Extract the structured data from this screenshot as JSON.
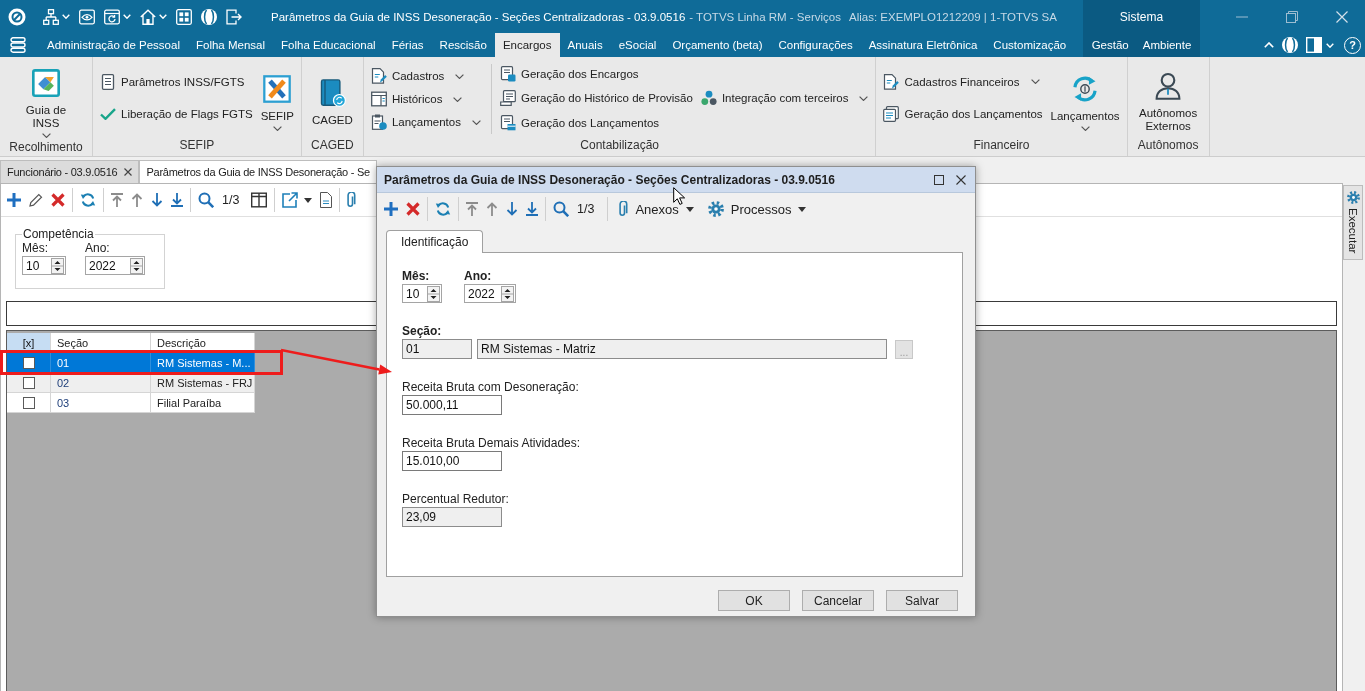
{
  "window": {
    "title": "Parâmetros da Guia de INSS Desoneração - Seções Centralizadoras - 03.9.0516",
    "product": "- TOTVS Linha RM - Serviços",
    "alias": "Alias: EXEMPLO1212209 | 1-TOTVS SA",
    "system_label": "Sistema"
  },
  "menu": {
    "items": [
      {
        "label": "Administração de Pessoal",
        "selected": false
      },
      {
        "label": "Folha Mensal",
        "selected": false
      },
      {
        "label": "Folha Educacional",
        "selected": false
      },
      {
        "label": "Férias",
        "selected": false
      },
      {
        "label": "Rescisão",
        "selected": false
      },
      {
        "label": "Encargos",
        "selected": true
      },
      {
        "label": "Anuais",
        "selected": false
      },
      {
        "label": "eSocial",
        "selected": false
      },
      {
        "label": "Orçamento (beta)",
        "selected": false
      },
      {
        "label": "Configurações",
        "selected": false
      },
      {
        "label": "Assinatura Eletrônica",
        "selected": false
      },
      {
        "label": "Customização",
        "selected": false
      }
    ],
    "system_items": [
      {
        "label": "Gestão",
        "selected": false
      },
      {
        "label": "Ambiente",
        "selected": false
      }
    ],
    "help_label": "?"
  },
  "ribbon": {
    "groups": [
      {
        "label": "Recolhimento",
        "columns": [
          {
            "divider": false,
            "items": [
              {
                "kind": "large",
                "lines": [
                  "Guia de",
                  "INSS"
                ],
                "dropdown": true
              }
            ]
          }
        ]
      },
      {
        "label": "SEFIP",
        "columns": [
          {
            "divider": false,
            "items": [
              {
                "kind": "small",
                "label": "Parâmetros INSS/FGTS",
                "dropdown": false
              },
              {
                "kind": "small",
                "label": "Liberação de Flags FGTS",
                "dropdown": false
              }
            ]
          },
          {
            "divider": false,
            "items": [
              {
                "kind": "large",
                "lines": [
                  "SEFIP"
                ],
                "dropdown": true
              }
            ]
          }
        ]
      },
      {
        "label": "CAGED",
        "columns": [
          {
            "divider": false,
            "items": [
              {
                "kind": "large",
                "lines": [
                  "CAGED"
                ],
                "dropdown": false
              }
            ]
          }
        ]
      },
      {
        "label": "Contabilização",
        "columns": [
          {
            "divider": true,
            "items": [
              {
                "kind": "small",
                "label": "Cadastros",
                "dropdown": true
              },
              {
                "kind": "small",
                "label": "Históricos",
                "dropdown": true
              },
              {
                "kind": "small",
                "label": "Lançamentos",
                "dropdown": true
              }
            ]
          },
          {
            "divider": false,
            "items": [
              {
                "kind": "small",
                "label": "Geração dos Encargos",
                "dropdown": false
              },
              {
                "kind": "small",
                "label": "Geração do Histórico de Provisão",
                "dropdown": false
              },
              {
                "kind": "small",
                "label": "Geração dos Lançamentos",
                "dropdown": false
              }
            ]
          },
          {
            "divider": false,
            "items": [
              {
                "kind": "small",
                "label": "Integração com terceiros",
                "dropdown": true
              }
            ]
          }
        ]
      },
      {
        "label": "Financeiro",
        "columns": [
          {
            "divider": false,
            "items": [
              {
                "kind": "small",
                "label": "Cadastros Financeiros",
                "dropdown": true
              },
              {
                "kind": "small",
                "label": "Geração dos Lançamentos",
                "dropdown": false
              }
            ]
          },
          {
            "divider": false,
            "items": [
              {
                "kind": "large",
                "lines": [
                  "Lançamentos"
                ],
                "dropdown": true
              }
            ]
          }
        ]
      },
      {
        "label": "Autônomos",
        "columns": [
          {
            "divider": false,
            "items": [
              {
                "kind": "large",
                "lines": [
                  "Autônomos",
                  "Externos"
                ],
                "dropdown": false
              }
            ]
          }
        ]
      }
    ]
  },
  "document_tabs": [
    {
      "label": "Funcionário - 03.9.0516",
      "selected": false,
      "closable": true
    },
    {
      "label": "Parâmetros da Guia de INSS Desoneração - Se",
      "selected": true,
      "closable": false
    }
  ],
  "side_panel": {
    "label": "Executar"
  },
  "toolbar": {
    "record_counter": "1/3"
  },
  "competencia": {
    "legend": "Competência",
    "month": {
      "label": "Mês:",
      "value": "10"
    },
    "year": {
      "label": "Ano:",
      "value": "2022"
    }
  },
  "grid": {
    "checkbox_header": "[x]",
    "columns": [
      "Seção",
      "Descrição"
    ],
    "rows": [
      {
        "checked": false,
        "selected": true,
        "cells": [
          "01",
          "RM Sistemas - M..."
        ]
      },
      {
        "checked": false,
        "selected": false,
        "cells": [
          "02",
          "RM Sistemas - FRJ"
        ]
      },
      {
        "checked": false,
        "selected": false,
        "cells": [
          "03",
          "Filial Paraíba"
        ]
      }
    ]
  },
  "dialog": {
    "title": "Parâmetros da Guia de INSS Desoneração - Seções Centralizadoras - 03.9.0516",
    "toolbar": {
      "record_counter": "1/3",
      "menus": [
        {
          "label": "Anexos"
        },
        {
          "label": "Processos"
        }
      ]
    },
    "tabs": [
      {
        "label": "Identificação",
        "selected": true
      }
    ],
    "month": {
      "label": "Mês:",
      "value": "10",
      "required": true
    },
    "year": {
      "label": "Ano:",
      "value": "2022",
      "required": true
    },
    "secao": {
      "label": "Seção:",
      "required": true,
      "code": "01",
      "description": "RM Sistemas - Matriz",
      "readonly": true,
      "lookup": {
        "label": "...",
        "disabled": true
      }
    },
    "amounts": [
      {
        "label": "Receita Bruta com Desoneração:",
        "value": "50.000,11",
        "required": false,
        "readonly": false
      },
      {
        "label": "Receita Bruta Demais Atividades:",
        "value": "15.010,00",
        "required": false,
        "readonly": false
      },
      {
        "label": "Percentual Redutor:",
        "value": "23,09",
        "required": false,
        "readonly": true
      }
    ],
    "buttons": [
      {
        "label": "OK"
      },
      {
        "label": "Cancelar"
      },
      {
        "label": "Salvar"
      }
    ]
  }
}
